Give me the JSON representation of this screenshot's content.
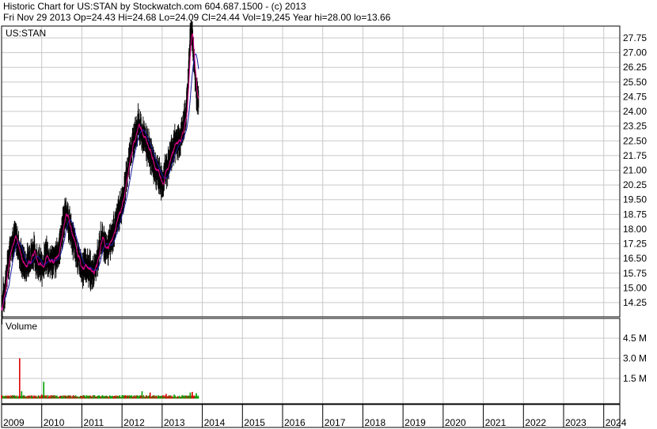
{
  "header": {
    "line1": "Historic Chart for US:STAN by Stockwatch.com 604.687.1500 - (c) 2013",
    "line2": "Fri Nov 29 2013  Op=24.43  Hi=24.68  Lo=24.09  Cl=24.44  Vol=19,245  Year hi=28.00  lo=13.66"
  },
  "colors": {
    "background": "#ffffff",
    "grid": "#c8c8c8",
    "frame": "#000000",
    "price_bars": "#000000",
    "ma_short": "#e0008c",
    "ma_long": "#1a1aa0",
    "volume_up": "#00a000",
    "volume_down": "#e00000"
  },
  "chart_data": [
    {
      "type": "line",
      "title": "US:STAN",
      "ylim": [
        13.66,
        28.2
      ],
      "yticks": [
        "14.25",
        "15.00",
        "15.75",
        "16.50",
        "17.25",
        "18.00",
        "18.75",
        "19.50",
        "20.25",
        "21.00",
        "21.75",
        "22.50",
        "23.25",
        "24.00",
        "24.75",
        "25.50",
        "26.25",
        "27.00",
        "27.75"
      ],
      "x_range": [
        2009.0,
        2024.4
      ],
      "series": [
        {
          "x": [
            2009.0,
            2009.1,
            2009.2,
            2009.3,
            2009.4,
            2009.5,
            2009.6,
            2009.7,
            2009.8,
            2009.9,
            2010.0,
            2010.1,
            2010.2,
            2010.3,
            2010.4,
            2010.5,
            2010.6,
            2010.7,
            2010.8,
            2010.9,
            2011.0,
            2011.1,
            2011.2,
            2011.3,
            2011.4,
            2011.5,
            2011.6,
            2011.7,
            2011.8,
            2011.9,
            2012.0,
            2012.1,
            2012.2,
            2012.3,
            2012.4,
            2012.5,
            2012.6,
            2012.7,
            2012.8,
            2012.9,
            2013.0,
            2013.1,
            2013.2,
            2013.3,
            2013.4,
            2013.5,
            2013.6,
            2013.65,
            2013.7,
            2013.75,
            2013.8,
            2013.85,
            2013.91
          ],
          "values": [
            14.0,
            15.2,
            16.8,
            17.6,
            17.3,
            16.4,
            16.1,
            16.5,
            16.9,
            16.3,
            16.0,
            16.6,
            16.4,
            16.3,
            16.7,
            17.8,
            18.9,
            18.1,
            17.3,
            16.6,
            15.8,
            16.3,
            15.9,
            15.8,
            16.6,
            17.6,
            17.0,
            17.2,
            17.9,
            18.7,
            19.3,
            20.4,
            21.8,
            22.6,
            23.4,
            22.8,
            22.4,
            21.9,
            21.2,
            20.9,
            20.3,
            21.0,
            21.6,
            22.3,
            22.5,
            22.9,
            23.9,
            25.8,
            27.7,
            28.0,
            26.4,
            25.0,
            24.4
          ]
        }
      ]
    },
    {
      "type": "bar",
      "title": "Volume",
      "yticks": [
        "1.5 M",
        "3.0 M",
        "4.5 M"
      ],
      "ylim": [
        0,
        5.4
      ],
      "x": [
        2009.0,
        2009.4,
        2009.45,
        2009.5,
        2009.75,
        2010.0,
        2010.05,
        2010.5,
        2011.0,
        2011.5,
        2011.75,
        2012.0,
        2012.4,
        2012.5,
        2012.7,
        2012.9,
        2013.1,
        2013.3,
        2013.5,
        2013.7,
        2013.75,
        2013.85
      ],
      "values": [
        0.25,
        0.15,
        3.0,
        0.55,
        0.2,
        0.3,
        1.25,
        0.18,
        0.2,
        0.22,
        0.15,
        0.25,
        0.2,
        0.55,
        0.45,
        0.2,
        0.35,
        0.3,
        0.25,
        0.45,
        0.5,
        0.4
      ],
      "up": [
        false,
        true,
        false,
        true,
        true,
        false,
        true,
        true,
        false,
        true,
        true,
        true,
        true,
        true,
        false,
        true,
        false,
        true,
        true,
        true,
        false,
        true
      ]
    }
  ],
  "x_tick_labels": [
    "2009",
    "2010",
    "2011",
    "2012",
    "2013",
    "2014",
    "2015",
    "2016",
    "2017",
    "2018",
    "2019",
    "2020",
    "2021",
    "2022",
    "2023",
    "2024"
  ]
}
